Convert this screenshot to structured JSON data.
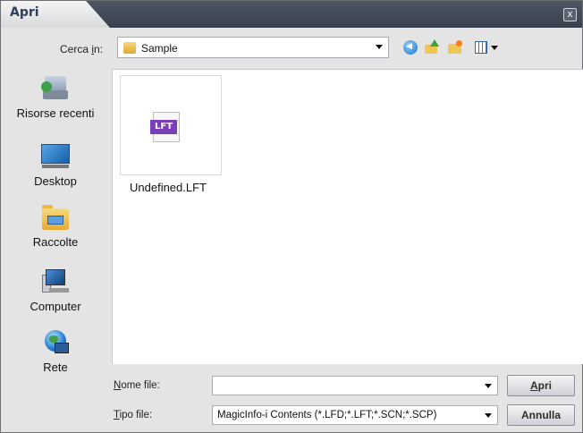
{
  "window": {
    "title": "Apri",
    "close_glyph": "x"
  },
  "toolbar": {
    "lookin_prefix": "Cerca ",
    "lookin_hotkey": "i",
    "lookin_suffix": "n:",
    "lookin_value": "Sample",
    "icons": [
      "back-icon",
      "up-folder-icon",
      "new-folder-icon",
      "views-menu-icon"
    ]
  },
  "places": [
    {
      "label": "Risorse recenti",
      "icon": "recent-places-icon"
    },
    {
      "label": "Desktop",
      "icon": "desktop-icon"
    },
    {
      "label": "Raccolte",
      "icon": "libraries-icon"
    },
    {
      "label": "Computer",
      "icon": "computer-icon"
    },
    {
      "label": "Rete",
      "icon": "network-icon"
    }
  ],
  "files": [
    {
      "name": "Undefined.LFT",
      "badge": "LFT",
      "badge_color": "#7a3fb8"
    }
  ],
  "filename": {
    "hotkey": "N",
    "label_rest": "ome file:",
    "value": ""
  },
  "filetype": {
    "hotkey": "T",
    "label_rest": "ipo file:",
    "value": "MagicInfo-i Contents (*.LFD;*.LFT;*.SCN;*.SCP)"
  },
  "buttons": {
    "open_hotkey": "A",
    "open_rest": "pri",
    "cancel": "Annulla"
  }
}
